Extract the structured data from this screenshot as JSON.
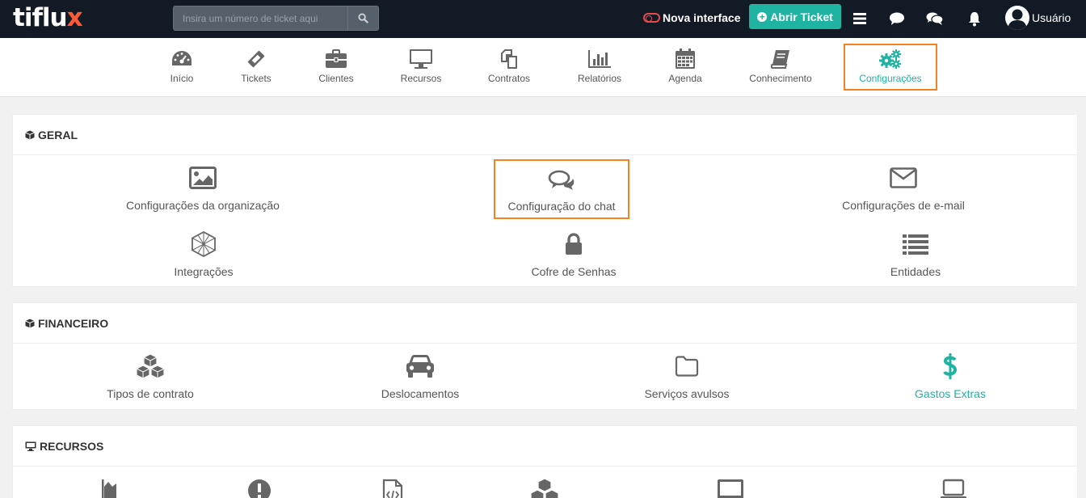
{
  "topbar": {
    "logo_main": "tiflu",
    "logo_x": "x",
    "search_placeholder": "Insira um número de ticket aqui",
    "nova_interface": "Nova interface",
    "abrir_ticket": "Abrir Ticket",
    "user_label": "Usuário"
  },
  "nav": {
    "items": [
      {
        "label": "Início",
        "icon": "dashboard-icon"
      },
      {
        "label": "Tickets",
        "icon": "ticket-icon"
      },
      {
        "label": "Clientes",
        "icon": "briefcase-icon"
      },
      {
        "label": "Recursos",
        "icon": "monitor-icon"
      },
      {
        "label": "Contratos",
        "icon": "copy-icon"
      },
      {
        "label": "Relatórios",
        "icon": "bar-chart-icon"
      },
      {
        "label": "Agenda",
        "icon": "calendar-icon"
      },
      {
        "label": "Conhecimento",
        "icon": "book-icon"
      },
      {
        "label": "Configurações",
        "icon": "gears-icon"
      }
    ],
    "active_item": "Configurações"
  },
  "sections": {
    "geral": {
      "title": "GERAL",
      "items": [
        {
          "label": "Configurações da organização",
          "icon": "image-icon"
        },
        {
          "label": "Configuração do chat",
          "icon": "chat-icon"
        },
        {
          "label": "Configurações de e-mail",
          "icon": "envelope-icon"
        },
        {
          "label": "Integrações",
          "icon": "hexagon-network-icon"
        },
        {
          "label": "Cofre de Senhas",
          "icon": "lock-icon"
        },
        {
          "label": "Entidades",
          "icon": "list-icon"
        }
      ]
    },
    "financeiro": {
      "title": "FINANCEIRO",
      "items": [
        {
          "label": "Tipos de contrato",
          "icon": "cubes-icon"
        },
        {
          "label": "Deslocamentos",
          "icon": "car-icon"
        },
        {
          "label": "Serviços avulsos",
          "icon": "folder-icon"
        },
        {
          "label": "Gastos Extras",
          "icon": "dollar-icon"
        }
      ]
    },
    "recursos": {
      "title": "RECURSOS",
      "items": [
        {
          "icon": "area-chart-icon"
        },
        {
          "icon": "exclamation-icon"
        },
        {
          "icon": "code-file-icon"
        },
        {
          "icon": "cubes-icon"
        },
        {
          "icon": "tablet-icon"
        },
        {
          "icon": "laptop-icon"
        }
      ]
    }
  },
  "colors": {
    "topbar_bg": "#121b25",
    "accent_teal": "#1fb3a2",
    "highlight_orange": "#f58220",
    "logo_x": "#ff5a36",
    "toggle_red": "#e84b4b"
  }
}
